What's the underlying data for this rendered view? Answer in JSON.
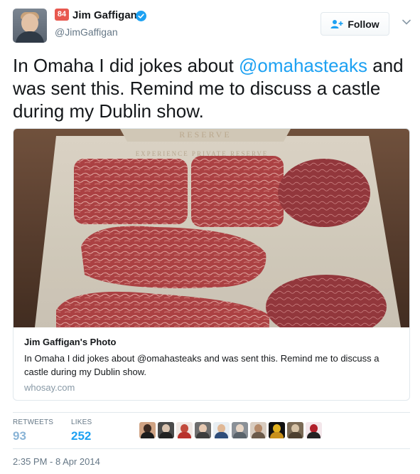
{
  "author": {
    "badge": "84",
    "name": "Jim Gaffigan",
    "handle": "@JimGaffigan",
    "verified": true
  },
  "follow_button": {
    "label": "Follow",
    "icon": "add-user-icon"
  },
  "tweet": {
    "text_before": "In Omaha I did jokes about ",
    "mention": "@omahasteaks",
    "text_after": " and was sent this.  Remind me to discuss a castle during my Dublin show."
  },
  "card": {
    "title": "Jim Gaffigan's Photo",
    "description": "In Omaha I did jokes about @omahasteaks and was sent this. Remind me to discuss a castle during my Dublin show.",
    "domain": "whosay.com",
    "photo_text": [
      "RESERVE",
      "EXPERIENCE PRIVATE RESERVE"
    ]
  },
  "stats": {
    "retweets_label": "RETWEETS",
    "retweets": "93",
    "likes_label": "LIKES",
    "likes": "252"
  },
  "timestamp": "2:35 PM - 8 Apr 2014",
  "colors": {
    "accent": "#1da1f2",
    "badge": "#e8584f",
    "muted": "#657786"
  }
}
